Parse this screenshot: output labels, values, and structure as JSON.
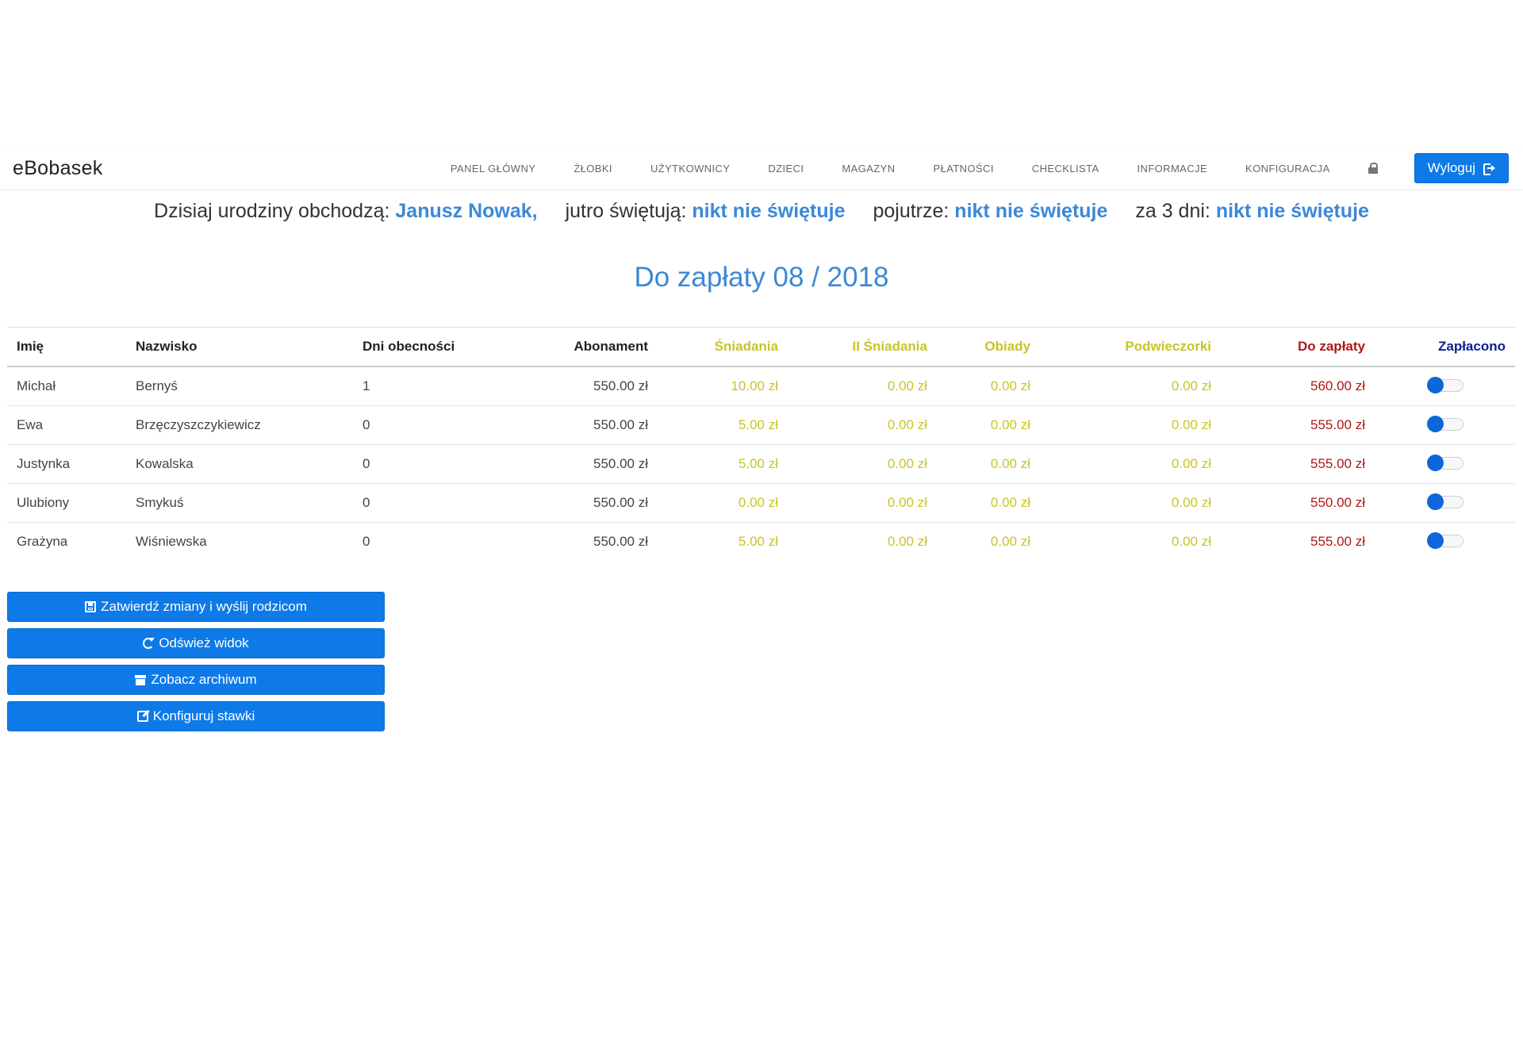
{
  "app": {
    "brand": "eBobasek",
    "nav": [
      "PANEL GŁÓWNY",
      "ŻŁOBKI",
      "UŻYTKOWNICY",
      "DZIECI",
      "MAGAZYN",
      "PŁATNOŚCI",
      "CHECKLISTA",
      "INFORMACJE",
      "KONFIGURACJA"
    ],
    "lock_icon": "lock-icon",
    "logout_label": "Wyloguj",
    "logout_icon": "sign-out-icon"
  },
  "birthdays": {
    "today_label": "Dzisiaj urodziny obchodzą:",
    "today_value": "Janusz Nowak,",
    "tomorrow_label": "jutro świętują:",
    "tomorrow_value": "nikt nie świętuje",
    "day_after_label": "pojutrze:",
    "day_after_value": "nikt nie świętuje",
    "in3_label": "za 3 dni:",
    "in3_value": "nikt nie świętuje",
    "highlight_color": "#3c88d6"
  },
  "title": "Do zapłaty 08 / 2018",
  "table": {
    "headers": [
      "Imię",
      "Nazwisko",
      "Dni obecności",
      "Abonament",
      "Śniadania",
      "II Śniadania",
      "Obiady",
      "Podwieczorki",
      "Do zapłaty",
      "Zapłacono"
    ],
    "rows": [
      {
        "first": "Michał",
        "last": "Bernyś",
        "days": "1",
        "subscription": "550.00 zł",
        "breakfast": "10.00 zł",
        "second_breakfast": "0.00 zł",
        "lunch": "0.00 zł",
        "snack": "0.00 zł",
        "due": "560.00 zł",
        "paid": false
      },
      {
        "first": "Ewa",
        "last": "Brzęczyszczykiewicz",
        "days": "0",
        "subscription": "550.00 zł",
        "breakfast": "5.00 zł",
        "second_breakfast": "0.00 zł",
        "lunch": "0.00 zł",
        "snack": "0.00 zł",
        "due": "555.00 zł",
        "paid": false
      },
      {
        "first": "Justynka",
        "last": "Kowalska",
        "days": "0",
        "subscription": "550.00 zł",
        "breakfast": "5.00 zł",
        "second_breakfast": "0.00 zł",
        "lunch": "0.00 zł",
        "snack": "0.00 zł",
        "due": "555.00 zł",
        "paid": false
      },
      {
        "first": "Ulubiony",
        "last": "Smykuś",
        "days": "0",
        "subscription": "550.00 zł",
        "breakfast": "0.00 zł",
        "second_breakfast": "0.00 zł",
        "lunch": "0.00 zł",
        "snack": "0.00 zł",
        "due": "550.00 zł",
        "paid": false
      },
      {
        "first": "Grażyna",
        "last": "Wiśniewska",
        "days": "0",
        "subscription": "550.00 zł",
        "breakfast": "5.00 zł",
        "second_breakfast": "0.00 zł",
        "lunch": "0.00 zł",
        "snack": "0.00 zł",
        "due": "555.00 zł",
        "paid": false
      }
    ],
    "colors": {
      "meal": "#c8c525",
      "due": "#b01818",
      "paid_header": "#0b1f99"
    }
  },
  "actions": {
    "submit_label": "Zatwierdź zmiany i wyślij rodzicom",
    "submit_icon": "save-icon",
    "refresh_label": "Odśwież widok",
    "refresh_icon": "refresh-icon",
    "archive_label": "Zobacz archiwum",
    "archive_icon": "archive-icon",
    "rates_label": "Konfiguruj stawki",
    "rates_icon": "edit-icon"
  },
  "accent_color": "#0d7ae8"
}
